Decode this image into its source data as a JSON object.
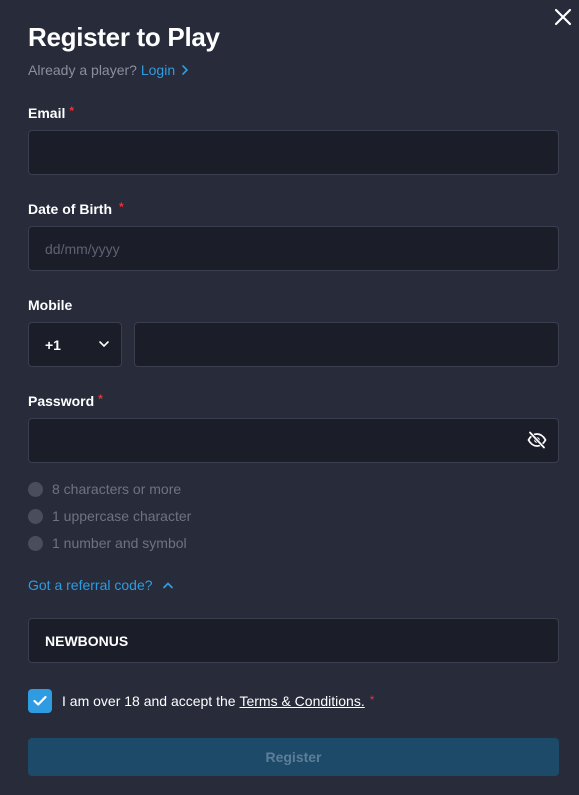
{
  "header": {
    "title": "Register to Play",
    "already_player": "Already a player?",
    "login_link": "Login"
  },
  "email": {
    "label": "Email",
    "required": "*",
    "value": ""
  },
  "dob": {
    "label": "Date of Birth",
    "required": "*",
    "placeholder": "dd/mm/yyyy",
    "value": ""
  },
  "mobile": {
    "label": "Mobile",
    "country_code": "+1",
    "value": ""
  },
  "password": {
    "label": "Password",
    "required": "*",
    "value": "",
    "rules": [
      "8 characters or more",
      "1 uppercase character",
      "1 number and symbol"
    ]
  },
  "referral": {
    "toggle_label": "Got a referral code?",
    "value": "NEWBONUS"
  },
  "terms": {
    "checked": true,
    "text": "I am over 18 and accept the",
    "link": "Terms & Conditions.",
    "required": "*"
  },
  "register_button": "Register",
  "colors": {
    "accent": "#2f9be0",
    "background": "#272b3a",
    "field_bg": "#1b1e29",
    "required": "#e0343f",
    "register_disabled": "#1e4a6a"
  },
  "icons": {
    "close": "close-icon",
    "login_chevron": "chevron-right-icon",
    "country_dropdown": "chevron-down-icon",
    "password_toggle": "eye-off-icon",
    "rule_status": "circle-icon",
    "referral_toggle": "chevron-up-icon",
    "checkbox": "checkmark-icon"
  }
}
